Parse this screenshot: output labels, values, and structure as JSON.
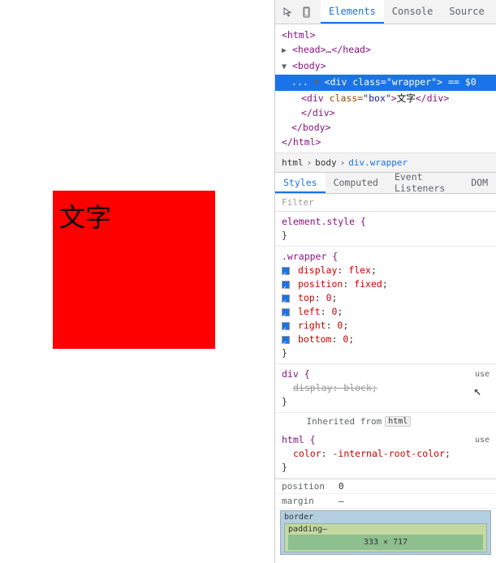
{
  "preview": {
    "chinese_text": "文字"
  },
  "devtools": {
    "top_tabs": [
      {
        "label": "≡",
        "icon": true
      },
      {
        "label": "⬡",
        "icon": true
      },
      {
        "label": "Elements",
        "active": true
      },
      {
        "label": "Console"
      },
      {
        "label": "Source"
      }
    ],
    "html_tree": {
      "lines": [
        {
          "text": "<html>",
          "indent": 1
        },
        {
          "text": "▶ <head>…</head>",
          "indent": 1
        },
        {
          "text": "▼ <body>",
          "indent": 1
        },
        {
          "text": "<div class=\"wrapper\"> == $0",
          "indent": 2,
          "selected": true,
          "prefix": "▼ "
        },
        {
          "text": "<div class=\"box\">文字</div>",
          "indent": 3
        },
        {
          "text": "</div>",
          "indent": 3
        },
        {
          "text": "</body>",
          "indent": 2
        },
        {
          "text": "</html>",
          "indent": 1
        }
      ]
    },
    "breadcrumb": {
      "items": [
        "html",
        "body",
        "div.wrapper"
      ]
    },
    "sub_tabs": [
      "Styles",
      "Computed",
      "Event Listeners",
      "DOM"
    ],
    "active_sub_tab": "Styles",
    "filter_placeholder": "Filter",
    "css_rules": [
      {
        "selector": "element.style {",
        "closing": "}",
        "properties": []
      },
      {
        "selector": ".wrapper {",
        "closing": "}",
        "properties": [
          {
            "name": "display",
            "value": "flex",
            "checked": true
          },
          {
            "name": "position",
            "value": "fixed",
            "checked": true
          },
          {
            "name": "top",
            "value": "0",
            "checked": true
          },
          {
            "name": "left",
            "value": "0",
            "checked": true
          },
          {
            "name": "right",
            "value": "0",
            "checked": true
          },
          {
            "name": "bottom",
            "value": "0",
            "checked": true
          }
        ]
      },
      {
        "selector": "div {",
        "closing": "}",
        "source": "user",
        "properties": [
          {
            "name": "display",
            "value": "block",
            "checked": true,
            "strikethrough": true
          }
        ]
      }
    ],
    "inherited_from": "html",
    "inherited_rule": {
      "selector": "html {",
      "closing": "}",
      "source": "user",
      "properties": [
        {
          "name": "color",
          "value": "-internal-root-color"
        }
      ]
    },
    "box_model": {
      "label_position": "position",
      "value_position": "0",
      "label_margin": "margin",
      "value_margin": "–",
      "label_border": "border",
      "label_padding": "padding–",
      "content_size": "333 × 717"
    }
  }
}
